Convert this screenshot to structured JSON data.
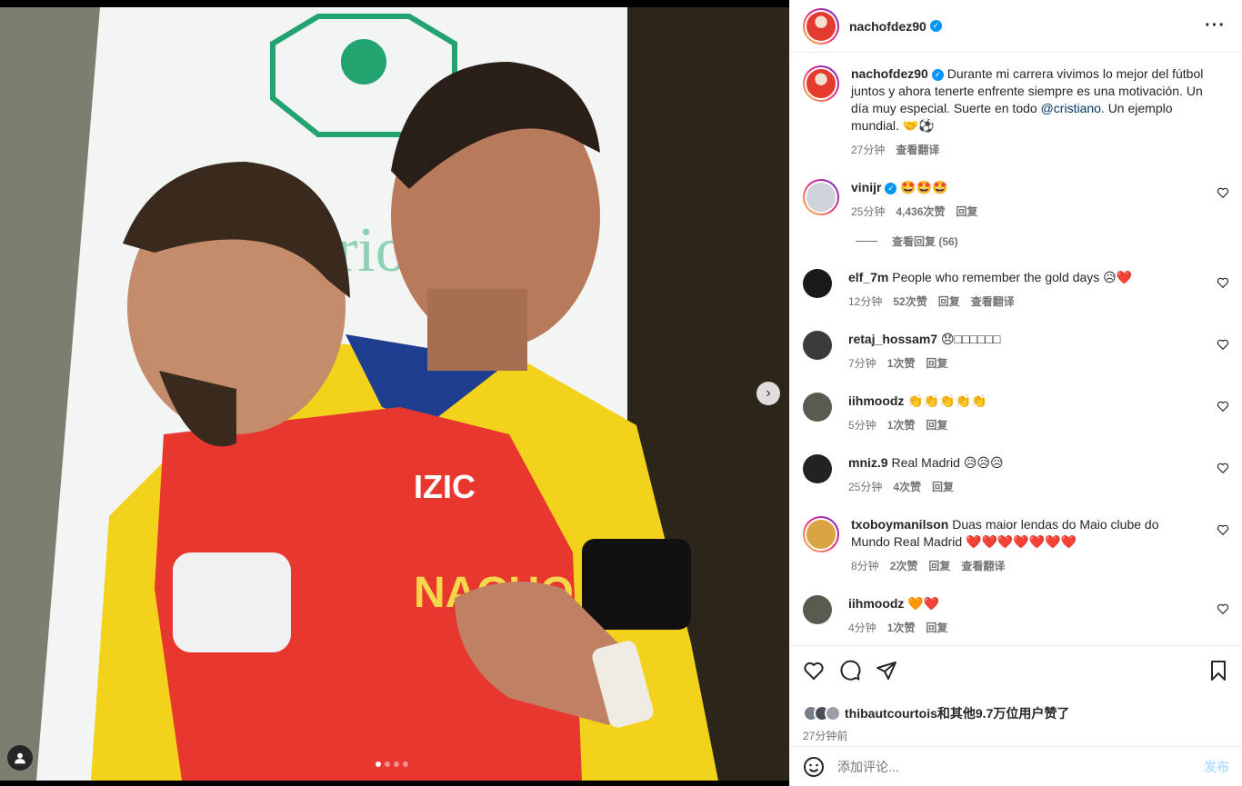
{
  "post": {
    "author": "nachofdez90",
    "more_icon": "more-horizontal-icon",
    "caption": {
      "username": "nachofdez90",
      "text": "Durante mi carrera vivimos lo mejor del fútbol juntos y ahora tenerte enfrente siempre es una motivación. Un día muy especial. Suerte en todo ",
      "mention": "@cristiano",
      "text_after": ". Un ejemplo mundial. 🤝⚽",
      "time": "27分钟",
      "translate": "查看翻译"
    },
    "carousel": {
      "slides": 4,
      "active_slide": 1,
      "next_icon": "chevron-right-icon"
    }
  },
  "comments": [
    {
      "username": "vinijr",
      "verified": true,
      "text": "🤩🤩🤩",
      "time": "25分钟",
      "likes": "4,436次赞",
      "reply": "回复",
      "view_replies": "查看回复 (56)",
      "story_ring": true,
      "avatar_color": "#cfd4da"
    },
    {
      "username": "elf_7m",
      "text": "People who remember the gold days 😥❤️",
      "time": "12分钟",
      "likes": "52次赞",
      "reply": "回复",
      "translate": "查看翻译",
      "avatar_color": "#1a1a1a"
    },
    {
      "username": "retaj_hossam7",
      "text": "😞□□□□□□",
      "time": "7分钟",
      "likes": "1次赞",
      "reply": "回复",
      "avatar_color": "#3b3b3b"
    },
    {
      "username": "iihmoodz",
      "text": "👏👏👏👏👏",
      "time": "5分钟",
      "likes": "1次赞",
      "reply": "回复",
      "avatar_color": "#5a5a50"
    },
    {
      "username": "mniz.9",
      "text": "Real Madrid 😥😥😥",
      "time": "25分钟",
      "likes": "4次赞",
      "reply": "回复",
      "avatar_color": "#222222"
    },
    {
      "username": "txoboymanilson",
      "text": "Duas maior lendas do Maio clube do Mundo Real Madrid ❤️❤️❤️❤️❤️❤️❤️",
      "time": "8分钟",
      "likes": "2次赞",
      "reply": "回复",
      "translate": "查看翻译",
      "story_ring": true,
      "avatar_color": "#d9a441"
    },
    {
      "username": "iihmoodz",
      "text": "🧡❤️",
      "time": "4分钟",
      "likes": "1次赞",
      "reply": "回复",
      "avatar_color": "#5a5a50"
    }
  ],
  "actions": {
    "like_icon": "heart-icon",
    "comment_icon": "comment-icon",
    "share_icon": "send-icon",
    "save_icon": "bookmark-icon",
    "liked_by_user": "thibautcourtois",
    "liked_by_rest": "和其他9.7万位用户赞了",
    "posted_ago": "27分钟前"
  },
  "composer": {
    "emoji_icon": "emoji-icon",
    "placeholder": "添加评论...",
    "post_label": "发布"
  }
}
